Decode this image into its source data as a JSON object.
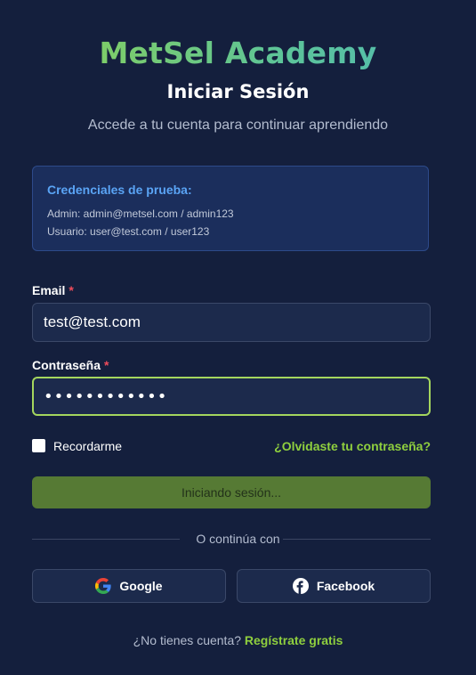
{
  "header": {
    "brand": "MetSel Academy",
    "title": "Iniciar Sesión",
    "subtitle": "Accede a tu cuenta para continuar aprendiendo"
  },
  "credentials": {
    "title": "Credenciales de prueba:",
    "admin": "Admin: admin@metsel.com / admin123",
    "user": "Usuario: user@test.com / user123"
  },
  "form": {
    "email_label": "Email",
    "email_value": "test@test.com",
    "password_label": "Contraseña",
    "password_value": "••••••••••••",
    "required_mark": "*",
    "remember_label": "Recordarme",
    "remember_checked": false,
    "forgot_link": "¿Olvidaste tu contraseña?",
    "submit_label": "Iniciando sesión..."
  },
  "social": {
    "divider_text": "O continúa con",
    "google_label": "Google",
    "facebook_label": "Facebook"
  },
  "footer": {
    "prompt": "¿No tienes cuenta?",
    "signup_link": "Regístrate gratis"
  },
  "colors": {
    "background": "#141f3d",
    "accent_green": "#8fcf3e",
    "info_blue": "#5aa4f5",
    "required_red": "#ef4b5b",
    "facebook_blue": "#1877f2"
  }
}
